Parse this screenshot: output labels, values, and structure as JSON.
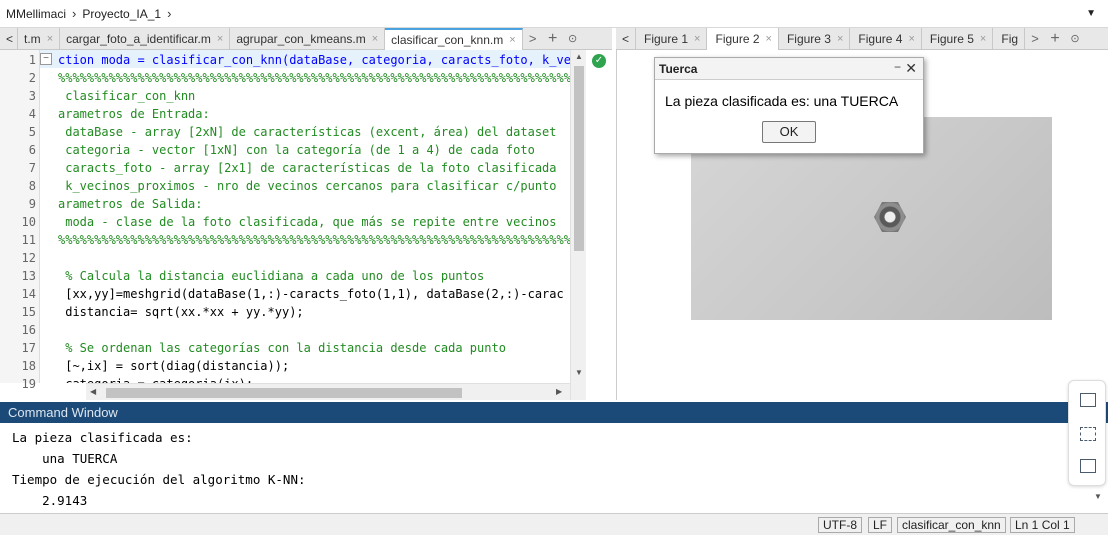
{
  "breadcrumb": {
    "items": [
      "MMellimaci",
      "Proyecto_IA_1"
    ]
  },
  "editor": {
    "tabs": [
      {
        "label": "t.m",
        "close": "×"
      },
      {
        "label": "cargar_foto_a_identificar.m",
        "close": "×"
      },
      {
        "label": "agrupar_con_kmeans.m",
        "close": "×"
      },
      {
        "label": "clasificar_con_knn.m",
        "close": "×"
      }
    ],
    "active_tab": "clasificar_con_knn.m",
    "lines": [
      {
        "n": "1",
        "text": "ction moda = clasificar_con_knn(dataBase, categoria, caracts_foto, k_ve",
        "style": "k"
      },
      {
        "n": "2",
        "text": "%%%%%%%%%%%%%%%%%%%%%%%%%%%%%%%%%%%%%%%%%%%%%%%%%%%%%%%%%%%%%%%%%%%%%%%%%",
        "style": "c"
      },
      {
        "n": "3",
        "text": " clasificar_con_knn",
        "style": "c"
      },
      {
        "n": "4",
        "text": "arametros de Entrada:",
        "style": "c"
      },
      {
        "n": "5",
        "text": " dataBase - array [2xN] de características (excent, área) del dataset",
        "style": "c"
      },
      {
        "n": "6",
        "text": " categoria - vector [1xN] con la categoría (de 1 a 4) de cada foto",
        "style": "c"
      },
      {
        "n": "7",
        "text": " caracts_foto - array [2x1] de características de la foto clasificada",
        "style": "c"
      },
      {
        "n": "8",
        "text": " k_vecinos_proximos - nro de vecinos cercanos para clasificar c/punto",
        "style": "c"
      },
      {
        "n": "9",
        "text": "arametros de Salida:",
        "style": "c"
      },
      {
        "n": "10",
        "text": " moda - clase de la foto clasificada, que más se repite entre vecinos",
        "style": "c"
      },
      {
        "n": "11",
        "text": "%%%%%%%%%%%%%%%%%%%%%%%%%%%%%%%%%%%%%%%%%%%%%%%%%%%%%%%%%%%%%%%%%%%%%%%%%",
        "style": "c"
      },
      {
        "n": "12",
        "text": "",
        "style": ""
      },
      {
        "n": "13",
        "text": " % Calcula la distancia euclidiana a cada uno de los puntos",
        "style": "c"
      },
      {
        "n": "14",
        "text": " [xx,yy]=meshgrid(dataBase(1,:)-caracts_foto(1,1), dataBase(2,:)-carac",
        "style": ""
      },
      {
        "n": "15",
        "text": " distancia= sqrt(xx.*xx + yy.*yy);",
        "style": ""
      },
      {
        "n": "16",
        "text": "",
        "style": ""
      },
      {
        "n": "17",
        "text": " % Se ordenan las categorías con la distancia desde cada punto",
        "style": "c"
      },
      {
        "n": "18",
        "text": " [~,ix] = sort(diag(distancia));",
        "style": ""
      },
      {
        "n": "19",
        "text": " categoria = categoria(ix);",
        "style": ""
      }
    ]
  },
  "figures": {
    "tabs": [
      "Figure 1",
      "Figure 2",
      "Figure 3",
      "Figure 4",
      "Figure 5",
      "Fig"
    ],
    "active_tab": "Figure 2"
  },
  "dialog": {
    "title": "Tuerca",
    "message": "La pieza clasificada es: una TUERCA",
    "ok_label": "OK"
  },
  "command_window": {
    "title": "Command Window",
    "lines": [
      "La pieza clasificada es:",
      "    una TUERCA",
      "Tiempo de ejecución del algoritmo K-NN:",
      "    2.9143"
    ]
  },
  "statusbar": {
    "encoding": "UTF-8",
    "line_ending": "LF",
    "file": "clasificar_con_knn",
    "position": "Ln  1  Col  1"
  }
}
